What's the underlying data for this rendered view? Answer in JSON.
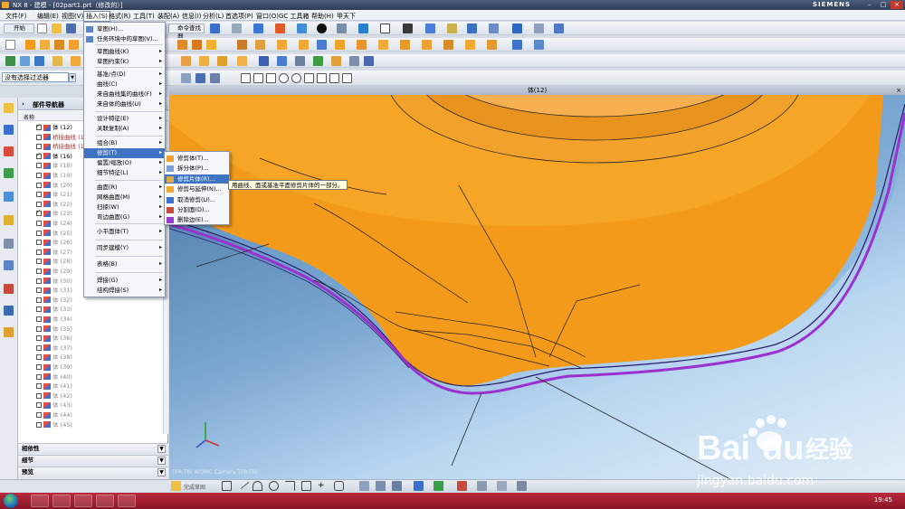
{
  "window": {
    "title": "NX 8 - 建模 - [02part1.prt（修改的）]",
    "brand": "SIEMENS"
  },
  "menubar": [
    "文件(F)",
    "编辑(E)",
    "视图(V)",
    "插入(S)",
    "格式(R)",
    "工具(T)",
    "装配(A)",
    "信息(I)",
    "分析(L)",
    "首选项(P)",
    "窗口(O)",
    "GC 工具箱",
    "帮助(H)",
    "甲天下"
  ],
  "toolbar": {
    "start_label": "开始",
    "command_finder": "命令查找器",
    "filter_select": "没有选择过滤器"
  },
  "insert_menu": [
    {
      "label": "草图(H)...",
      "sub": false
    },
    {
      "label": "任务环境中的草图(V)...",
      "sub": false
    },
    {
      "label": "草图曲线(K)",
      "sub": true
    },
    {
      "label": "草图约束(K)",
      "sub": true
    },
    {
      "label": "基准/点(D)",
      "sub": true
    },
    {
      "label": "曲线(C)",
      "sub": true
    },
    {
      "label": "来自曲线集的曲线(F)",
      "sub": true
    },
    {
      "label": "来自体的曲线(U)",
      "sub": true
    },
    {
      "label": "设计特征(E)",
      "sub": true
    },
    {
      "label": "关联复制(A)",
      "sub": true
    },
    {
      "label": "组合(B)",
      "sub": true
    },
    {
      "label": "修剪(T)",
      "sub": true
    },
    {
      "label": "偏置/缩放(O)",
      "sub": true
    },
    {
      "label": "细节特征(L)",
      "sub": true
    },
    {
      "label": "曲面(R)",
      "sub": true
    },
    {
      "label": "网格曲面(M)",
      "sub": true
    },
    {
      "label": "扫掠(W)",
      "sub": true
    },
    {
      "label": "弯边曲面(G)",
      "sub": true
    },
    {
      "label": "小平面体(T)",
      "sub": true
    },
    {
      "label": "同步建模(Y)",
      "sub": true
    },
    {
      "label": "表格(B)",
      "sub": true
    },
    {
      "label": "焊接(G)",
      "sub": true
    },
    {
      "label": "结构焊接(S)",
      "sub": true
    }
  ],
  "trim_menu": [
    "修剪体(T)...",
    "拆分体(P)...",
    "修剪片体(R)...",
    "修剪与延伸(N)...",
    "取消修剪(U)...",
    "分割面(D)...",
    "删除边(E)..."
  ],
  "tooltip": "用曲线、面或基准平面修剪片体的一部分。",
  "navigator": {
    "title": "部件导航器",
    "col_name": "名称",
    "rows": [
      {
        "label": "体 (12)",
        "checked": true,
        "style": "normal"
      },
      {
        "label": "桥接曲线 (13)",
        "checked": false,
        "style": "red"
      },
      {
        "label": "桥接曲线 (14)",
        "checked": false,
        "style": "red"
      },
      {
        "label": "体 (16)",
        "checked": true,
        "style": "normal"
      },
      {
        "label": "体 (18)",
        "checked": false,
        "style": "grey"
      },
      {
        "label": "体 (19)",
        "checked": false,
        "style": "grey"
      },
      {
        "label": "体 (20)",
        "checked": false,
        "style": "grey"
      },
      {
        "label": "体 (21)",
        "checked": false,
        "style": "grey"
      },
      {
        "label": "体 (22)",
        "checked": false,
        "style": "grey"
      },
      {
        "label": "体 (23)",
        "checked": true,
        "style": "grey"
      },
      {
        "label": "体 (24)",
        "checked": false,
        "style": "grey"
      },
      {
        "label": "体 (25)",
        "checked": false,
        "style": "grey"
      },
      {
        "label": "体 (26)",
        "checked": false,
        "style": "grey"
      },
      {
        "label": "体 (27)",
        "checked": false,
        "style": "grey"
      },
      {
        "label": "体 (28)",
        "checked": false,
        "style": "grey"
      },
      {
        "label": "体 (29)",
        "checked": false,
        "style": "grey"
      },
      {
        "label": "体 (30)",
        "checked": false,
        "style": "grey"
      },
      {
        "label": "体 (31)",
        "checked": false,
        "style": "grey"
      },
      {
        "label": "体 (32)",
        "checked": false,
        "style": "grey"
      },
      {
        "label": "体 (33)",
        "checked": false,
        "style": "grey"
      },
      {
        "label": "体 (34)",
        "checked": false,
        "style": "grey"
      },
      {
        "label": "体 (35)",
        "checked": false,
        "style": "grey"
      },
      {
        "label": "体 (36)",
        "checked": false,
        "style": "grey"
      },
      {
        "label": "体 (37)",
        "checked": false,
        "style": "grey"
      },
      {
        "label": "体 (38)",
        "checked": false,
        "style": "grey"
      },
      {
        "label": "体 (39)",
        "checked": false,
        "style": "grey"
      },
      {
        "label": "体 (40)",
        "checked": false,
        "style": "grey"
      },
      {
        "label": "体 (41)",
        "checked": false,
        "style": "grey"
      },
      {
        "label": "体 (42)",
        "checked": false,
        "style": "grey"
      },
      {
        "label": "体 (43)",
        "checked": false,
        "style": "grey"
      },
      {
        "label": "体 (44)",
        "checked": false,
        "style": "grey"
      },
      {
        "label": "体 (45)",
        "checked": false,
        "style": "grey"
      }
    ],
    "panels": [
      "相依性",
      "细节",
      "预览"
    ]
  },
  "graphics": {
    "title": "体(12)",
    "camera": "TFR-TRI WORK: Camera TFR-TRI"
  },
  "sketchbar_label": "完成草图",
  "clock": "19:45",
  "watermark": {
    "brand": "Bai du 经验",
    "url": "jingyan.baidu.com"
  },
  "colors": {
    "accent": "#3f73c4",
    "body": "#f39a1a",
    "taskbar": "#a21f33"
  }
}
